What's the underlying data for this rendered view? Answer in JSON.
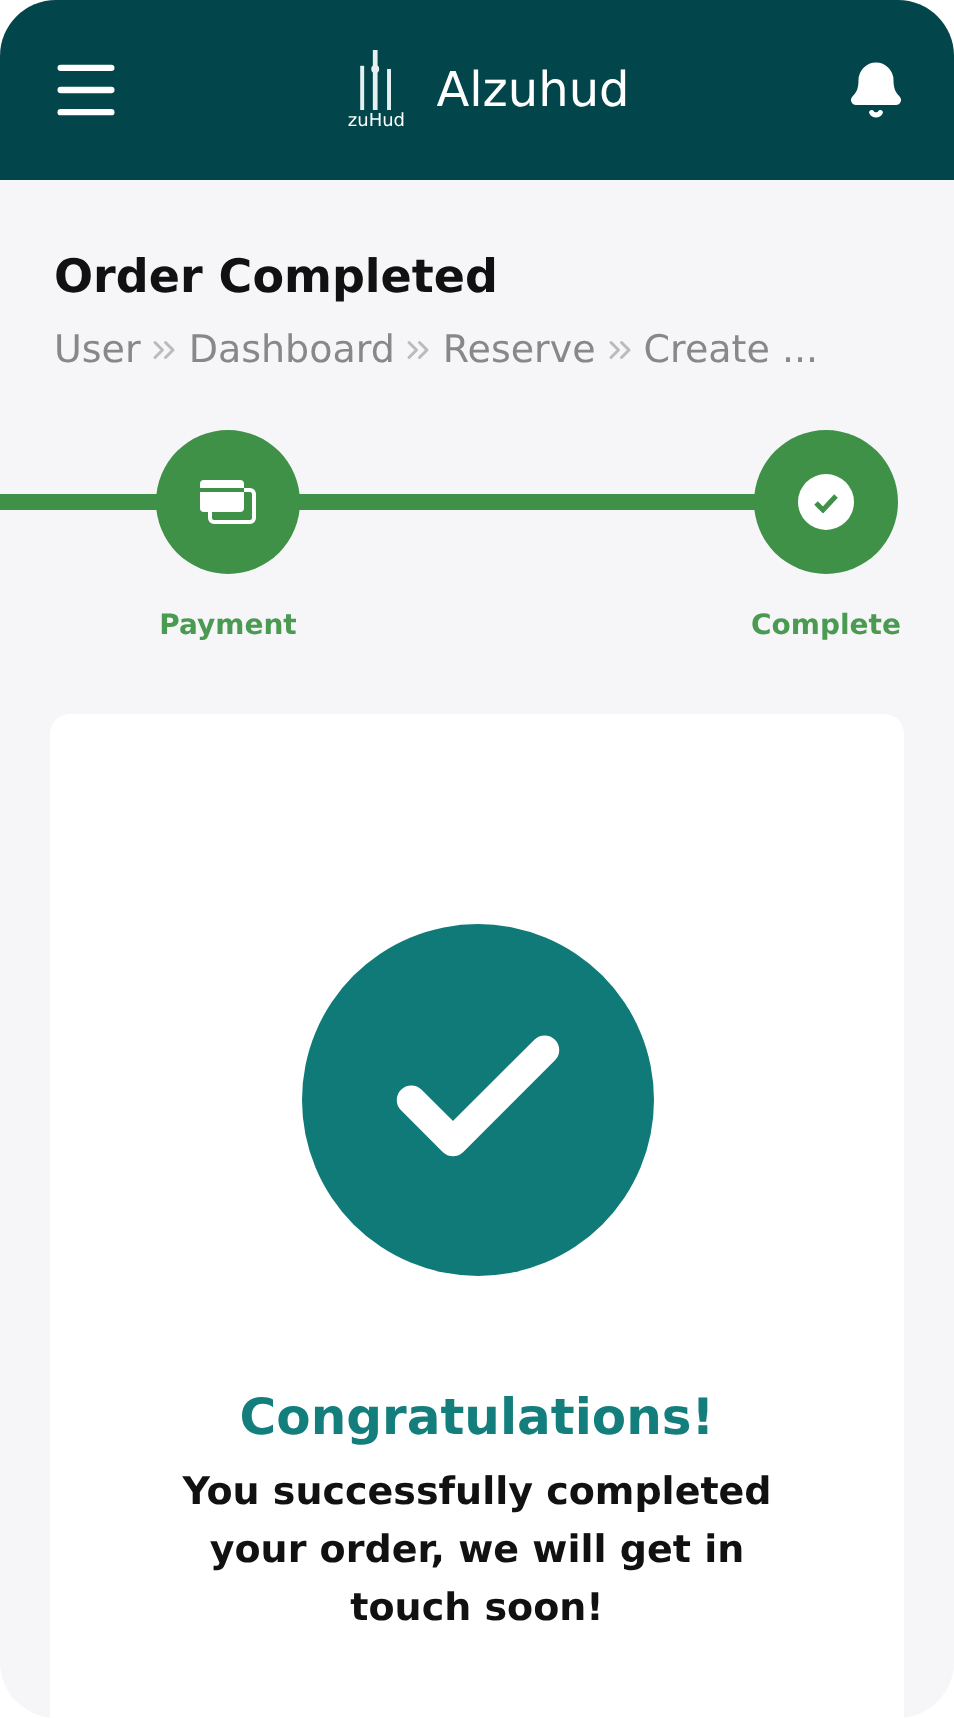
{
  "header": {
    "logo_text": "zuHud",
    "title": "Alzuhud"
  },
  "page": {
    "title": "Order Completed",
    "breadcrumb": [
      "User",
      "Dashboard",
      "Reserve",
      "Create ..."
    ]
  },
  "steps": [
    {
      "label": "Payment",
      "kind": "payment",
      "done": true
    },
    {
      "label": "Complete",
      "kind": "complete",
      "done": true
    }
  ],
  "result": {
    "title": "Congratulations!",
    "message": "You successfully completed your order, we will get in touch soon!"
  }
}
